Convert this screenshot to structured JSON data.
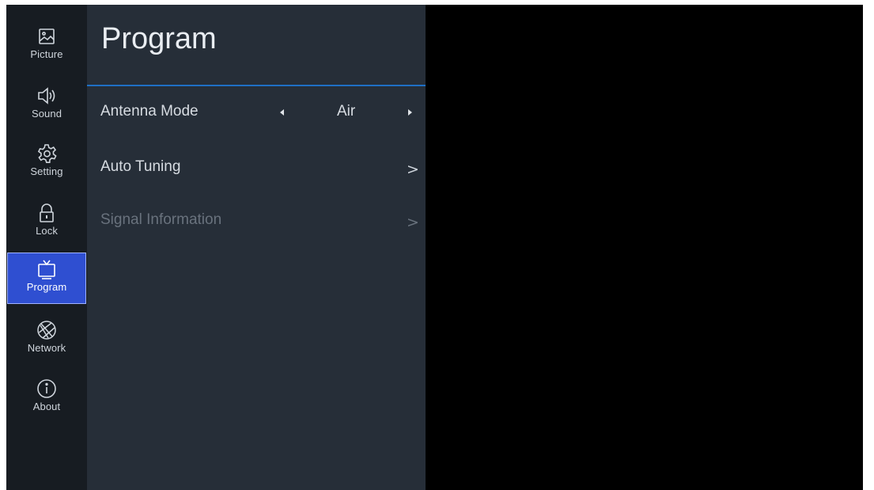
{
  "sidebar": {
    "items": [
      {
        "label": "Picture",
        "icon": "picture-icon"
      },
      {
        "label": "Sound",
        "icon": "speaker-icon"
      },
      {
        "label": "Setting",
        "icon": "gear-icon"
      },
      {
        "label": "Lock",
        "icon": "lock-icon"
      },
      {
        "label": "Program",
        "icon": "tv-icon",
        "active": true
      },
      {
        "label": "Network",
        "icon": "globe-icon"
      },
      {
        "label": "About",
        "icon": "info-icon"
      }
    ],
    "active_color": "#2f4fd1"
  },
  "panel": {
    "title": "Program",
    "accent_color": "#1f6fc4",
    "items": [
      {
        "label": "Antenna Mode",
        "value": "Air",
        "type": "selector"
      },
      {
        "label": "Auto Tuning",
        "type": "submenu"
      },
      {
        "label": "Signal Information",
        "type": "submenu",
        "disabled": true
      }
    ]
  }
}
